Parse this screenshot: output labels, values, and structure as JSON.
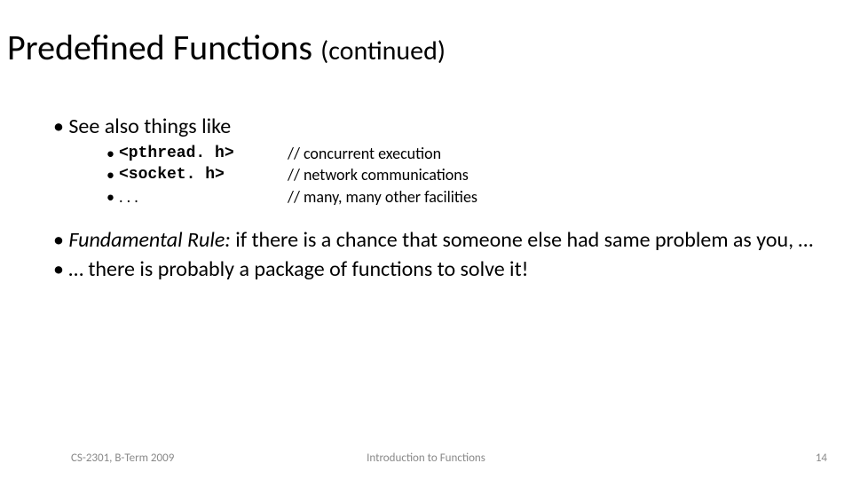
{
  "title": {
    "main": "Predefined Functions ",
    "sub": "(continued)"
  },
  "body": {
    "see_also": "• See also  things like",
    "items": [
      {
        "bullet": "•",
        "key": "<pthread. h>",
        "mono": true,
        "cmt": "// concurrent execution"
      },
      {
        "bullet": "•",
        "key": "<socket. h>",
        "mono": true,
        "cmt": "// network communications"
      },
      {
        "bullet": "•",
        "key": ". . .",
        "mono": false,
        "cmt": "// many, many other facilities"
      }
    ],
    "rule_prefix_italic": "Fundamental Rule:",
    "rule_rest": " if there is a chance that someone else had same problem as you, …",
    "rule_line2": "• … there is probably a package of functions to solve it!"
  },
  "footer": {
    "left": "CS-2301, B-Term 2009",
    "center": "Introduction to Functions",
    "right": "14"
  }
}
